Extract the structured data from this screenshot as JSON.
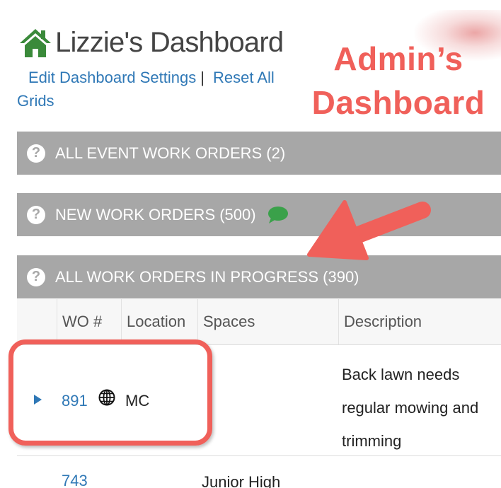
{
  "header": {
    "title": "Lizzie's Dashboard",
    "icon": "home-icon",
    "edit_link": "Edit Dashboard Settings",
    "separator": "|",
    "reset_link": "Reset All Grids"
  },
  "annotation": {
    "line1": "Admin’s",
    "line2": "Dashboard",
    "color": "#f0605a"
  },
  "sections": [
    {
      "label": "ALL EVENT WORK ORDERS (2)",
      "icon": "question-icon"
    },
    {
      "label": "NEW WORK ORDERS (500)",
      "icon": "question-icon",
      "extra_icon": "chat-bubble-icon"
    },
    {
      "label": "ALL WORK ORDERS IN PROGRESS (390)",
      "icon": "question-icon"
    }
  ],
  "table": {
    "columns": [
      "WO #",
      "Location",
      "Spaces",
      "Description"
    ],
    "rows": [
      {
        "wo": "891",
        "location_icon": "globe-icon",
        "location": "MC",
        "spaces": "",
        "description": "Back lawn needs regular mowing and trimming"
      },
      {
        "wo": "743",
        "location": "",
        "spaces": "Junior High",
        "description": ""
      }
    ]
  },
  "colors": {
    "link": "#2f78b6",
    "section_bar": "#a7a7a7",
    "accent": "#f0605a",
    "chat_icon": "#3aa14a",
    "home_icon": "#3a8a3a"
  }
}
